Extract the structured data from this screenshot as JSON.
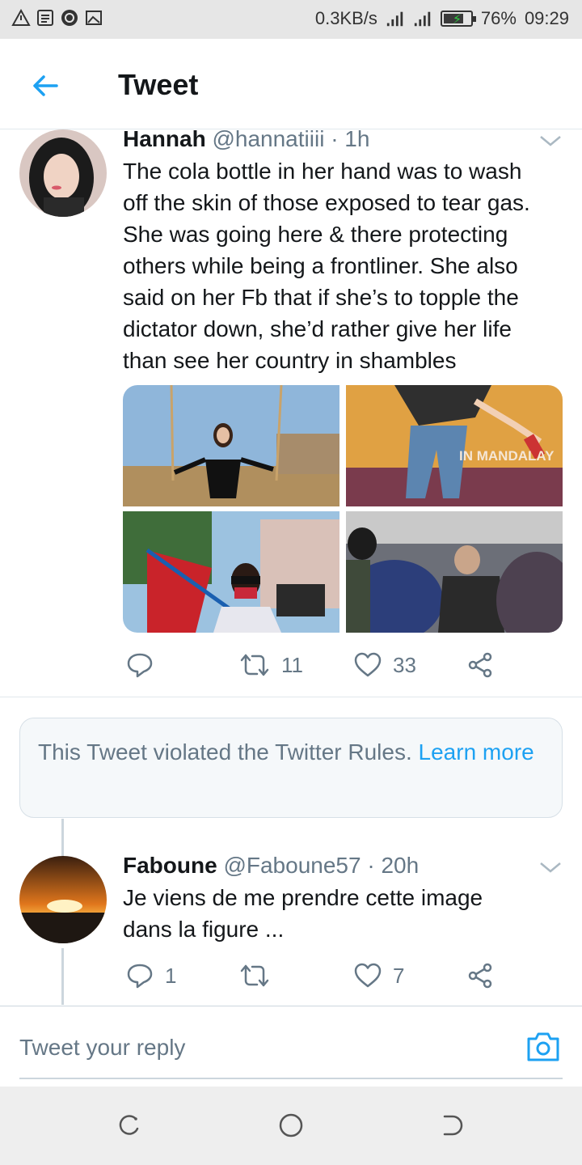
{
  "status_bar": {
    "network_speed": "0.3KB/s",
    "battery_percent": "76%",
    "battery_level": 0.76,
    "time": "09:29",
    "left_icons": [
      "alert-icon",
      "news-icon",
      "app-icon",
      "image-icon"
    ],
    "right_icons": [
      "signal-4g-icon",
      "signal-icon",
      "battery-icon"
    ]
  },
  "header": {
    "title": "Tweet",
    "back_icon": "arrow-left-icon"
  },
  "tweets": [
    {
      "name": "Hannah",
      "handle": "@hannatiiii",
      "time": "· 1h",
      "text_lines": [
        "The cola bottle in her hand was to wash",
        "off the skin of those exposed to tear gas.",
        "She was going here & there protecting",
        "others while being a frontliner. She also",
        "said on her Fb that if she’s to topple the",
        "dictator down, she’d rather give her life",
        "than see her country in shambles"
      ],
      "media_overlay_text": "IN MANDALAY",
      "replies": "",
      "retweets": "11",
      "likes": "33"
    },
    {
      "name": "Faboune",
      "handle": "@Faboune57",
      "time": "· 20h",
      "text_lines": [
        "Je viens de me prendre cette image",
        "dans la figure ..."
      ],
      "replies": "1",
      "retweets": "",
      "likes": "7"
    }
  ],
  "notice": {
    "text": "This Tweet violated the Twitter Rules.",
    "link": "Learn more"
  },
  "reply": {
    "placeholder": "Tweet your reply",
    "camera_icon": "camera-icon"
  },
  "colors": {
    "accent": "#1da1f2",
    "secondary_text": "#657786",
    "primary_text": "#14171a",
    "divider": "#e1e8ed"
  }
}
